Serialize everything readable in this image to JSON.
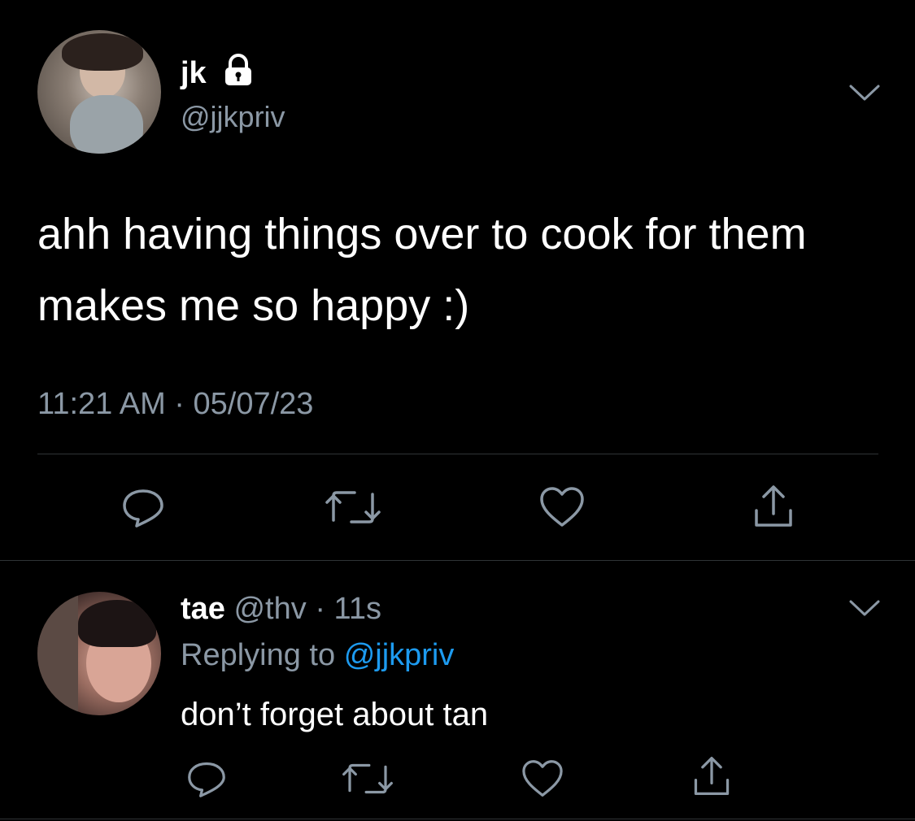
{
  "colors": {
    "background": "#000000",
    "text_primary": "#ffffff",
    "text_secondary": "#8b98a5",
    "link": "#1d9bf0",
    "divider": "#2f3336"
  },
  "main_tweet": {
    "display_name": "jk",
    "lock_icon": "lock-icon",
    "handle": "@jjkpriv",
    "menu_icon": "chevron-down-icon",
    "text": "ahh having things over to cook for them makes me so happy :)",
    "timestamp": "11:21 AM · 05/07/23",
    "actions": [
      "reply-icon",
      "retweet-icon",
      "like-icon",
      "share-icon"
    ]
  },
  "reply_tweet": {
    "display_name": "tae",
    "handle": "@thv",
    "separator": "·",
    "age": "11s",
    "replying_to_prefix": "Replying to",
    "replying_to_handle": "@jjkpriv",
    "menu_icon": "chevron-down-icon",
    "text": "don’t forget about tan",
    "actions": [
      "reply-icon",
      "retweet-icon",
      "like-icon",
      "share-icon"
    ]
  }
}
